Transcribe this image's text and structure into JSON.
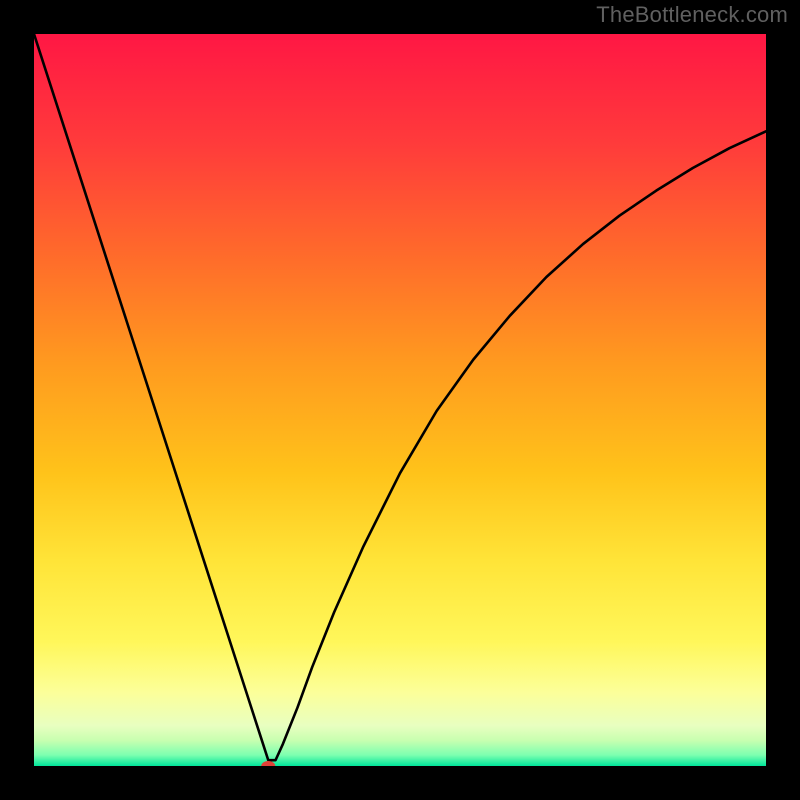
{
  "watermark": "TheBottleneck.com",
  "chart_data": {
    "type": "line",
    "title": "",
    "xlabel": "",
    "ylabel": "",
    "xlim": [
      0,
      100
    ],
    "ylim": [
      0,
      100
    ],
    "grid": false,
    "legend": false,
    "gradient_stops": [
      {
        "offset": 0.0,
        "color": "#ff1744"
      },
      {
        "offset": 0.15,
        "color": "#ff3b3b"
      },
      {
        "offset": 0.3,
        "color": "#ff6a2b"
      },
      {
        "offset": 0.45,
        "color": "#ff9a1f"
      },
      {
        "offset": 0.6,
        "color": "#ffc31a"
      },
      {
        "offset": 0.72,
        "color": "#ffe438"
      },
      {
        "offset": 0.83,
        "color": "#fff75a"
      },
      {
        "offset": 0.9,
        "color": "#fcff9a"
      },
      {
        "offset": 0.945,
        "color": "#e8ffc0"
      },
      {
        "offset": 0.965,
        "color": "#c8ffb0"
      },
      {
        "offset": 0.985,
        "color": "#7dffb0"
      },
      {
        "offset": 1.0,
        "color": "#00e59a"
      }
    ],
    "series": [
      {
        "name": "curve",
        "x": [
          0,
          5,
          10,
          15,
          20,
          25,
          28,
          30,
          31,
          32,
          33,
          34,
          36,
          38,
          41,
          45,
          50,
          55,
          60,
          65,
          70,
          75,
          80,
          85,
          90,
          95,
          100
        ],
        "y": [
          100,
          84.5,
          69,
          53.5,
          38,
          22.5,
          13.2,
          7.0,
          3.9,
          0.8,
          0.8,
          3.0,
          8.0,
          13.5,
          21.0,
          30.0,
          40.0,
          48.5,
          55.5,
          61.5,
          66.8,
          71.3,
          75.2,
          78.6,
          81.7,
          84.4,
          86.7
        ]
      }
    ],
    "marker": {
      "x": 32,
      "y": 0,
      "color": "#e04038",
      "rx": 7,
      "ry": 5
    }
  }
}
